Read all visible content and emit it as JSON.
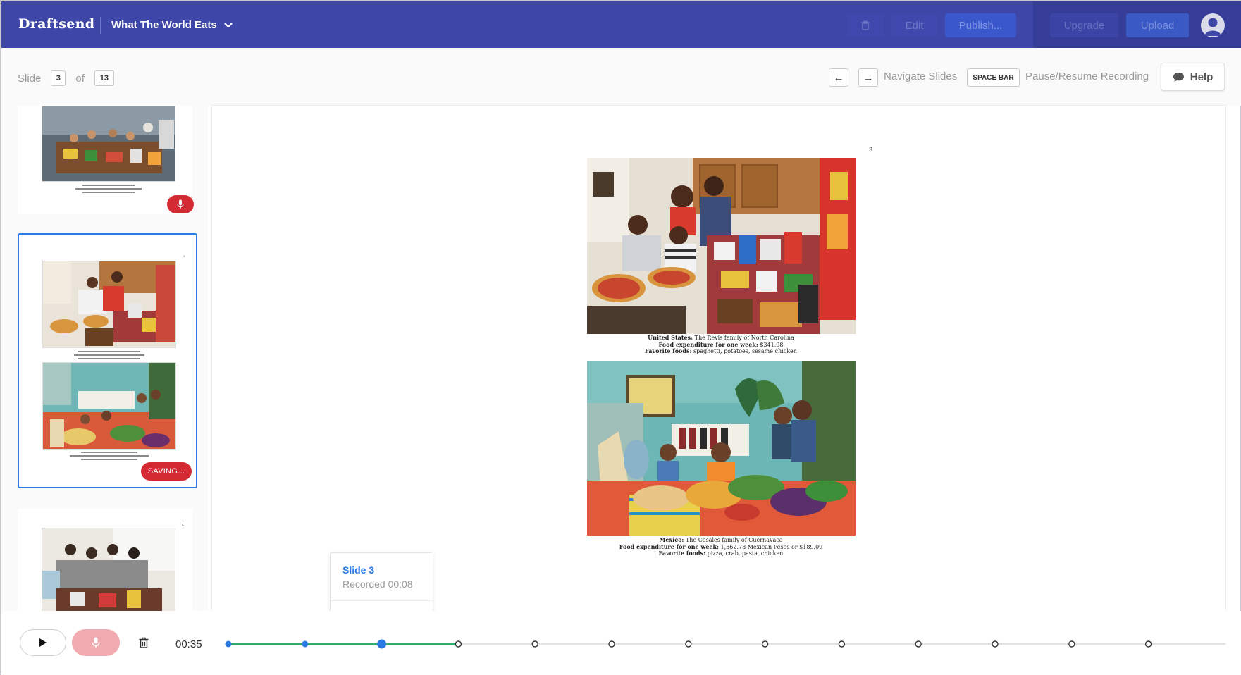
{
  "app": {
    "logo": "Draftsend",
    "project_title": "What The World Eats"
  },
  "toolbar": {
    "edit_label": "Edit",
    "publish_label": "Publish...",
    "upgrade_label": "Upgrade",
    "upload_label": "Upload"
  },
  "slide_indicator": {
    "prefix": "Slide",
    "current": "3",
    "of_label": "of",
    "total": "13"
  },
  "shortcuts": {
    "prev_key": "←",
    "next_key": "→",
    "navigate_label": "Navigate Slides",
    "space_key": "SPACE BAR",
    "pause_label": "Pause/Resume Recording"
  },
  "help": {
    "label": "Help"
  },
  "thumbnails": [
    {
      "state": "recorded"
    },
    {
      "state": "saving",
      "badge": "SAVING...",
      "page_num": "3"
    },
    {
      "state": "default",
      "page_num": "4"
    }
  ],
  "slide": {
    "page_number": "3",
    "photo1_caption": {
      "country": "United States:",
      "family": "The Revis family of North Carolina",
      "expenditure_label": "Food expenditure for one week:",
      "expenditure_value": "$341.98",
      "foods_label": "Favorite foods:",
      "foods_value": "spaghetti, potatoes, sesame chicken"
    },
    "photo2_caption": {
      "country": "Mexico:",
      "family": "The Casales family of Cuernavaca",
      "expenditure_label": "Food expenditure for one week:",
      "expenditure_value": "1,862.78 Mexican Pesos or $189.09",
      "foods_label": "Favorite foods:",
      "foods_value": "pizza, crab, pasta, chicken"
    }
  },
  "popover": {
    "title": "Slide 3",
    "subtitle": "Recorded 00:08"
  },
  "playback": {
    "elapsed": "00:35",
    "total_slides": 13,
    "recorded_slides": 3,
    "current_slide": 3
  },
  "colors": {
    "topbar": "#3e46a8",
    "accent_blue": "#2c7be5",
    "record_red": "#d42a33",
    "progress_green": "#2fae6a"
  }
}
